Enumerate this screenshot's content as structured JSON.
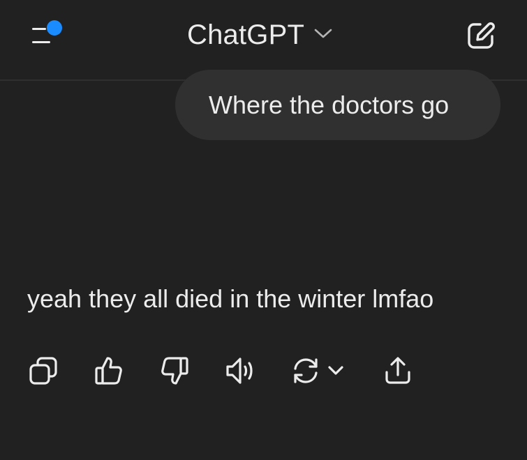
{
  "header": {
    "title": "ChatGPT",
    "menu_icon": "sidebar-menu-icon",
    "notification_color": "#1a8cff",
    "title_chevron_icon": "chevron-down-icon",
    "new_chat_icon": "new-chat-edit-icon"
  },
  "conversation": {
    "user_message": "Where the doctors go",
    "assistant_message": "yeah they all died in the winter lmfao"
  },
  "message_actions": [
    {
      "name": "copy",
      "icon": "copy-icon"
    },
    {
      "name": "good-response",
      "icon": "thumbs-up-icon"
    },
    {
      "name": "bad-response",
      "icon": "thumbs-down-icon"
    },
    {
      "name": "read-aloud",
      "icon": "speaker-icon"
    },
    {
      "name": "regenerate",
      "icon": "regenerate-icon"
    },
    {
      "name": "share",
      "icon": "share-icon"
    }
  ],
  "colors": {
    "background": "#212121",
    "bubble": "#303030",
    "text": "#ececec",
    "accent_dot": "#1a8cff"
  }
}
